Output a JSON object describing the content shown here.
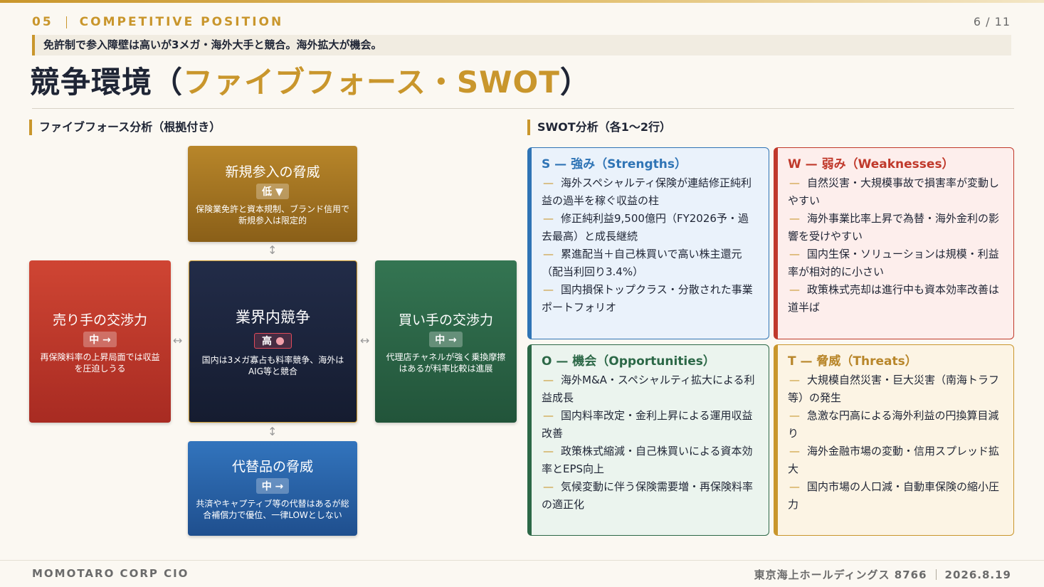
{
  "header": {
    "section_number": "05",
    "section_name": "COMPETITIVE POSITION",
    "page": "6 / 11",
    "lead": "免許制で参入障壁は高いが3メガ・海外大手と競合。海外拡大が機会。",
    "title_main": "競争環境（",
    "title_accent": "ファイブフォース・SWOT",
    "title_end": "）"
  },
  "five_forces": {
    "heading": "ファイブフォース分析（根拠付き）",
    "new_entrants": {
      "title": "新規参入の脅威",
      "level": "低 ▼",
      "desc": "保険業免許と資本規制、ブランド信用で新規参入は限定的"
    },
    "suppliers": {
      "title": "売り手の交渉力",
      "level": "中 →",
      "desc": "再保険料率の上昇局面では収益を圧迫しうる"
    },
    "rivalry": {
      "title": "業界内競争",
      "level": "高",
      "desc": "国内は3メガ寡占も料率競争、海外はAIG等と競合"
    },
    "buyers": {
      "title": "買い手の交渉力",
      "level": "中 →",
      "desc": "代理店チャネルが強く乗換摩擦はあるが料率比較は進展"
    },
    "substitutes": {
      "title": "代替品の脅威",
      "level": "中 →",
      "desc": "共済やキャプティブ等の代替はあるが総合補償力で優位、一律LOWとしない"
    },
    "arrows": {
      "vertical": "↕",
      "horizontal": "↔"
    }
  },
  "swot": {
    "heading": "SWOT分析（各1〜2行）",
    "dash": "—",
    "strengths": {
      "title": "S — 強み（Strengths）",
      "items": [
        "海外スペシャルティ保険が連結修正純利益の過半を稼ぐ収益の柱",
        "修正純利益9,500億円（FY2026予・過去最高）と成長継続",
        "累進配当＋自己株買いで高い株主還元（配当利回り3.4%）",
        "国内損保トップクラス・分散された事業ポートフォリオ"
      ]
    },
    "weaknesses": {
      "title": "W — 弱み（Weaknesses）",
      "items": [
        "自然災害・大規模事故で損害率が変動しやすい",
        "海外事業比率上昇で為替・海外金利の影響を受けやすい",
        "国内生保・ソリューションは規模・利益率が相対的に小さい",
        "政策株式売却は進行中も資本効率改善は道半ば"
      ]
    },
    "opportunities": {
      "title": "O — 機会（Opportunities）",
      "items": [
        "海外M&A・スペシャルティ拡大による利益成長",
        "国内料率改定・金利上昇による運用収益改善",
        "政策株式縮減・自己株買いによる資本効率とEPS向上",
        "気候変動に伴う保険需要増・再保険料率の適正化"
      ]
    },
    "threats": {
      "title": "T — 脅威（Threats）",
      "items": [
        "大規模自然災害・巨大災害（南海トラフ等）の発生",
        "急激な円高による海外利益の円換算目減り",
        "海外金融市場の変動・信用スプレッド拡大",
        "国内市場の人口減・自動車保険の縮小圧力"
      ]
    }
  },
  "footer": {
    "left": "MOMOTARO CORP CIO",
    "company": "東京海上ホールディングス 8766",
    "date": "2026.8.19"
  },
  "colors": {
    "accent": "#c9962c",
    "new_entrants": "#a87520",
    "suppliers": "#c0392b",
    "rivalry": "#1c2640",
    "buyers": "#2c6847",
    "substitutes": "#2a64a8",
    "strengths": "#2f74b5",
    "weaknesses": "#c0392b",
    "opportunities": "#2c6847",
    "threats": "#c9962c"
  }
}
